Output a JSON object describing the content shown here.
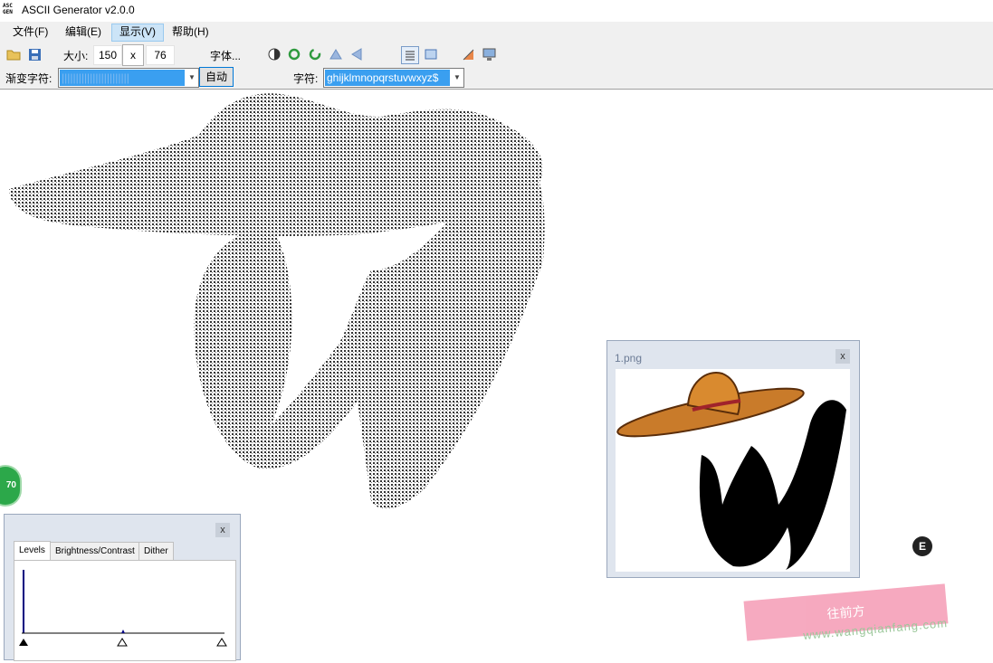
{
  "window": {
    "title": "ASCII Generator v2.0.0",
    "icon_text": "ASC\nGEN"
  },
  "menu": [
    {
      "label": "文件(F)"
    },
    {
      "label": "编辑(E)"
    },
    {
      "label": "显示(V)"
    },
    {
      "label": "帮助(H)"
    }
  ],
  "toolbar": {
    "size_label": "大小:",
    "width_value": "150",
    "x_label": "x",
    "height_value": "76",
    "font_label": "字体..."
  },
  "options": {
    "gradient_label": "渐变字符:",
    "gradient_value": "||||||||||||||||||||||||",
    "auto_label": "自动",
    "chars_label": "字符:",
    "chars_value": "ghijklmnopqrstuvwxyz$"
  },
  "image_window": {
    "title": "1.png",
    "close": "x"
  },
  "levels_window": {
    "close": "x",
    "tabs": [
      "Levels",
      "Brightness/Contrast",
      "Dither"
    ]
  },
  "overlays": {
    "side_badge": "70",
    "e_badge": "E",
    "watermark_text": "往前方",
    "watermark_url": "www.wangqianfang.com"
  }
}
